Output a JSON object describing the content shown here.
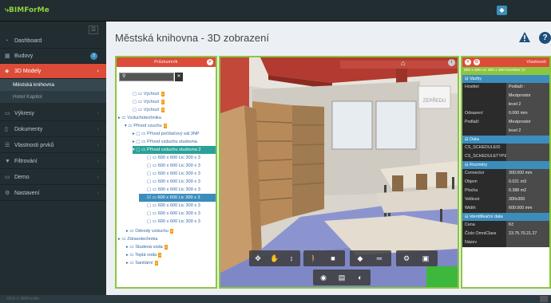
{
  "app": {
    "logo": "BIMForMe"
  },
  "sidebar": {
    "items": [
      {
        "icon": "dashboard-icon",
        "glyph": "◔",
        "label": "Dashboard"
      },
      {
        "icon": "building-icon",
        "glyph": "▦",
        "label": "Budovy",
        "badge": "2"
      },
      {
        "icon": "cube-icon",
        "glyph": "◈",
        "label": "3D Modely"
      },
      {
        "icon": "drawing-icon",
        "glyph": "▭",
        "label": "Výkresy"
      },
      {
        "icon": "document-icon",
        "glyph": "▯",
        "label": "Dokumenty"
      },
      {
        "icon": "list-icon",
        "glyph": "☰",
        "label": "Vlastnosti prvků"
      },
      {
        "icon": "filter-icon",
        "glyph": "▼",
        "label": "Filtrování"
      },
      {
        "icon": "monitor-icon",
        "glyph": "▭",
        "label": "Demo"
      },
      {
        "icon": "gear-icon",
        "glyph": "⚙",
        "label": "Nastavení"
      }
    ],
    "subitems": [
      "Městská knihovna",
      "Hotel Kapitol"
    ]
  },
  "page": {
    "title": "Městská knihovna - 3D zobrazení"
  },
  "explorer": {
    "title": "Průzkumník",
    "search_value": "",
    "tree": [
      {
        "label": "Výchozí",
        "count": "2"
      },
      {
        "label": "Výchozí",
        "count": "1"
      },
      {
        "label": "Výchozí",
        "count": "3"
      },
      {
        "label": "Vzduchotechnika",
        "count": ""
      },
      {
        "label": "Přívod vzuchu",
        "count": "3"
      },
      {
        "label": "Přívod počítačový sál 3NP",
        "count": ""
      },
      {
        "label": "Přívod vzduchu studovna",
        "count": ""
      },
      {
        "label": "Přívod vzduchu studovna 2",
        "count": ""
      },
      {
        "label": "600 x 600 Lic 300 x 3",
        "count": ""
      },
      {
        "label": "600 x 600 Lic 300 x 3",
        "count": ""
      },
      {
        "label": "600 x 600 Lic 300 x 3",
        "count": ""
      },
      {
        "label": "600 x 600 Lic 300 x 3",
        "count": ""
      },
      {
        "label": "600 x 600 Lic 300 x 3",
        "count": ""
      },
      {
        "label": "600 x 600 Lic 300 x 3",
        "count": ""
      },
      {
        "label": "600 x 600 Lic 300 x 3",
        "count": ""
      },
      {
        "label": "600 x 600 Lic 300 x 3",
        "count": ""
      },
      {
        "label": "600 x 600 Lic 300 x 3",
        "count": ""
      },
      {
        "label": "Odvody vzduchu",
        "count": "3"
      },
      {
        "label": "Zdravotechnika",
        "count": ""
      },
      {
        "label": "Studená voda",
        "count": "2"
      },
      {
        "label": "Teplá voda",
        "count": "1"
      },
      {
        "label": "Sanitární",
        "count": "3"
      }
    ]
  },
  "viewer": {
    "sign_text": "ZEPŘEDU"
  },
  "props": {
    "title": "Vlastnosti",
    "subtitle": "600 x 600 Lic 300 x 300 konektor (V",
    "sections": [
      {
        "title": "Vazby",
        "rows": [
          {
            "k": "Hostitel",
            "v": "Podlaží :"
          },
          {
            "k": "",
            "v": "Meziprostor"
          },
          {
            "k": "",
            "v": "level 2"
          },
          {
            "k": "Odsazení",
            "v": "0.000 mm"
          },
          {
            "k": "Podlaží",
            "v": "Meziprostor"
          },
          {
            "k": "",
            "v": "level 2"
          }
        ]
      },
      {
        "title": "Data",
        "rows": [
          {
            "k": "CS_SCHEDULEID",
            "v": ""
          },
          {
            "k": "CS_SCHEDULETYPE",
            "v": ""
          }
        ]
      },
      {
        "title": "Rozměry",
        "rows": [
          {
            "k": "Connector",
            "v": "300.000 mm"
          },
          {
            "k": "Objem",
            "v": "0.021 m3"
          },
          {
            "k": "Plocha",
            "v": "0.388 m2"
          },
          {
            "k": "Velikost",
            "v": "300x300"
          },
          {
            "k": "Width",
            "v": "600.000 mm"
          }
        ]
      },
      {
        "title": "Identifikační data",
        "rows": [
          {
            "k": "Cena",
            "v": "Kč"
          },
          {
            "k": "Číslo OmniClass",
            "v": "23.75.70.21.27"
          },
          {
            "k": "Název",
            "v": ""
          }
        ]
      }
    ]
  },
  "footer": {
    "text": "2018 © BIMForMe"
  }
}
